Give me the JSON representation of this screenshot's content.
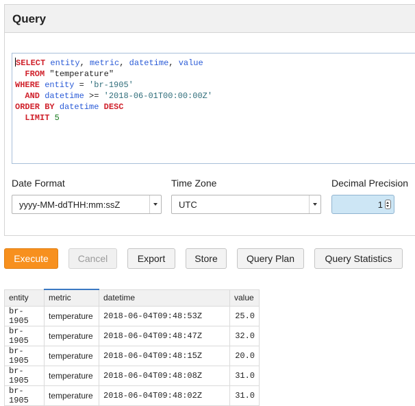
{
  "panel": {
    "title": "Query"
  },
  "editor": {
    "lines": [
      [
        {
          "t": "SELECT",
          "c": "kw"
        },
        {
          "t": " ",
          "c": ""
        },
        {
          "t": "entity",
          "c": "id"
        },
        {
          "t": ", ",
          "c": ""
        },
        {
          "t": "metric",
          "c": "id"
        },
        {
          "t": ", ",
          "c": ""
        },
        {
          "t": "datetime",
          "c": "id"
        },
        {
          "t": ", ",
          "c": ""
        },
        {
          "t": "value",
          "c": "id"
        }
      ],
      [
        {
          "t": "  ",
          "c": ""
        },
        {
          "t": "FROM",
          "c": "kw"
        },
        {
          "t": " \"temperature\"",
          "c": ""
        }
      ],
      [
        {
          "t": "WHERE",
          "c": "kw"
        },
        {
          "t": " ",
          "c": ""
        },
        {
          "t": "entity",
          "c": "id"
        },
        {
          "t": " = ",
          "c": ""
        },
        {
          "t": "'br-1905'",
          "c": "str"
        }
      ],
      [
        {
          "t": "  ",
          "c": ""
        },
        {
          "t": "AND",
          "c": "kw"
        },
        {
          "t": " ",
          "c": ""
        },
        {
          "t": "datetime",
          "c": "id"
        },
        {
          "t": " >= ",
          "c": ""
        },
        {
          "t": "'2018-06-01T00:00:00Z'",
          "c": "str"
        }
      ],
      [
        {
          "t": "ORDER BY",
          "c": "kw"
        },
        {
          "t": " ",
          "c": ""
        },
        {
          "t": "datetime",
          "c": "id"
        },
        {
          "t": " ",
          "c": ""
        },
        {
          "t": "DESC",
          "c": "kw"
        }
      ],
      [
        {
          "t": "  ",
          "c": ""
        },
        {
          "t": "LIMIT",
          "c": "kw"
        },
        {
          "t": " ",
          "c": ""
        },
        {
          "t": "5",
          "c": "num"
        }
      ]
    ]
  },
  "settings": {
    "date_format": {
      "label": "Date Format",
      "value": "yyyy-MM-ddTHH:mm:ssZ"
    },
    "time_zone": {
      "label": "Time Zone",
      "value": "UTC"
    },
    "decimal_precision": {
      "label": "Decimal Precision",
      "value": "1"
    }
  },
  "toolbar": {
    "execute": "Execute",
    "cancel": "Cancel",
    "export": "Export",
    "store": "Store",
    "query_plan": "Query Plan",
    "query_statistics": "Query Statistics"
  },
  "results": {
    "columns": [
      "entity",
      "metric",
      "datetime",
      "value"
    ],
    "rows": [
      [
        "br-1905",
        "temperature",
        "2018-06-04T09:48:53Z",
        "25.0"
      ],
      [
        "br-1905",
        "temperature",
        "2018-06-04T09:48:47Z",
        "32.0"
      ],
      [
        "br-1905",
        "temperature",
        "2018-06-04T09:48:15Z",
        "20.0"
      ],
      [
        "br-1905",
        "temperature",
        "2018-06-04T09:48:08Z",
        "31.0"
      ],
      [
        "br-1905",
        "temperature",
        "2018-06-04T09:48:02Z",
        "31.0"
      ]
    ]
  },
  "colors": {
    "accent": "#f7901e",
    "keyword": "#d0222c",
    "identifier": "#2a5bd7",
    "string": "#2f6d7a",
    "number": "#177a1d"
  }
}
